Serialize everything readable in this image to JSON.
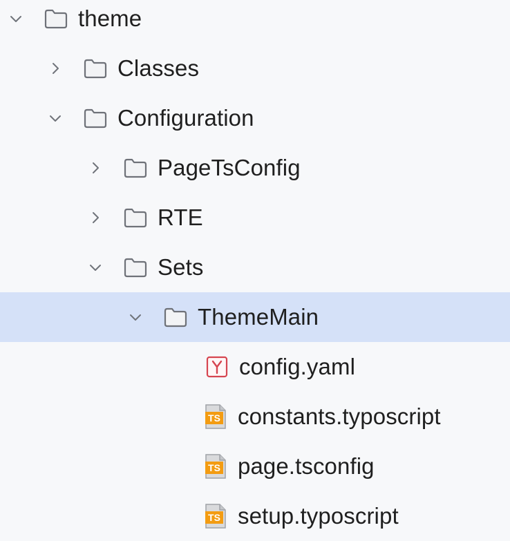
{
  "tree": {
    "nodes": [
      {
        "label": "theme",
        "expanded": true,
        "icon": "folder-icon",
        "type": "folder"
      },
      {
        "label": "Classes",
        "expanded": false,
        "icon": "folder-icon",
        "type": "folder"
      },
      {
        "label": "Configuration",
        "expanded": true,
        "icon": "folder-icon",
        "type": "folder"
      },
      {
        "label": "PageTsConfig",
        "expanded": false,
        "icon": "folder-icon",
        "type": "folder"
      },
      {
        "label": "RTE",
        "expanded": false,
        "icon": "folder-icon",
        "type": "folder"
      },
      {
        "label": "Sets",
        "expanded": true,
        "icon": "folder-icon",
        "type": "folder"
      },
      {
        "label": "ThemeMain",
        "expanded": true,
        "icon": "folder-icon",
        "type": "folder",
        "selected": true
      },
      {
        "label": "config.yaml",
        "icon": "yaml-file-icon",
        "type": "file",
        "icon_text": "Y"
      },
      {
        "label": "constants.typoscript",
        "icon": "typoscript-file-icon",
        "type": "file",
        "icon_text": "TS"
      },
      {
        "label": "page.tsconfig",
        "icon": "typoscript-file-icon",
        "type": "file",
        "icon_text": "TS"
      },
      {
        "label": "setup.typoscript",
        "icon": "typoscript-file-icon",
        "type": "file",
        "icon_text": "TS"
      }
    ]
  },
  "colors": {
    "background": "#f7f8fa",
    "selected_row": "#d5e1f8",
    "yaml_icon": "#d64550",
    "typoscript_icon": "#f39c12"
  }
}
